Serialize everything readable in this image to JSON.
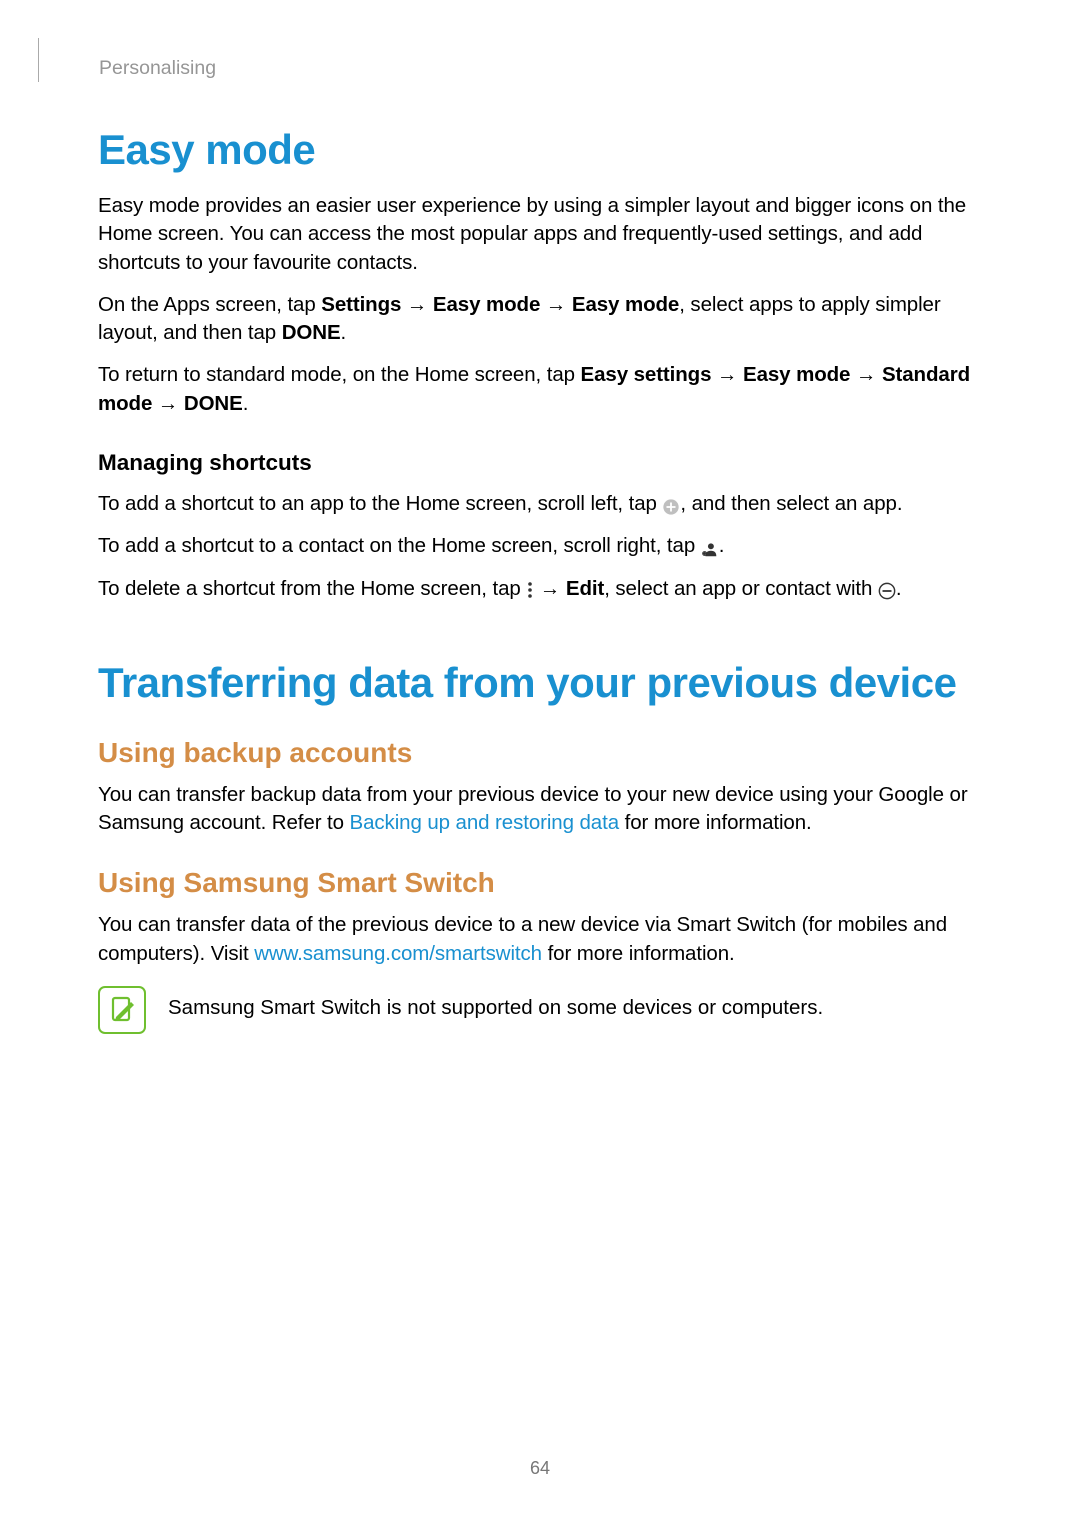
{
  "header": {
    "section": "Personalising"
  },
  "h1_easy": "Easy mode",
  "easy": {
    "p1": "Easy mode provides an easier user experience by using a simpler layout and bigger icons on the Home screen. You can access the most popular apps and frequently-used settings, and add shortcuts to your favourite contacts.",
    "p2a": "On the Apps screen, tap ",
    "p2b_settings": "Settings",
    "p2b_em1": "Easy mode",
    "p2b_em2": "Easy mode",
    "p2c": ", select apps to apply simpler layout, and then tap ",
    "p2d_done": "DONE",
    "p3a": "To return to standard mode, on the Home screen, tap ",
    "p3b_es": "Easy settings",
    "p3b_em": "Easy mode",
    "p3b_sm": "Standard mode",
    "p3b_done": "DONE"
  },
  "shortcuts": {
    "title": "Managing shortcuts",
    "p1a": "To add a shortcut to an app to the Home screen, scroll left, tap ",
    "p1b": ", and then select an app.",
    "p2a": "To add a shortcut to a contact on the Home screen, scroll right, tap ",
    "p3a": "To delete a shortcut from the Home screen, tap ",
    "p3b_edit": "Edit",
    "p3c": ", select an app or contact with "
  },
  "h1_transfer": "Transferring data from your previous device",
  "backup": {
    "title": "Using backup accounts",
    "p1a": "You can transfer backup data from your previous device to your new device using your Google or Samsung account. Refer to ",
    "link": "Backing up and restoring data",
    "p1b": " for more information."
  },
  "smartswitch": {
    "title": "Using Samsung Smart Switch",
    "p1a": "You can transfer data of the previous device to a new device via Smart Switch (for mobiles and computers). Visit ",
    "link": "www.samsung.com/smartswitch",
    "p1b": " for more information.",
    "note": "Samsung Smart Switch is not supported on some devices or computers."
  },
  "page_number": "64",
  "arrow": " → "
}
